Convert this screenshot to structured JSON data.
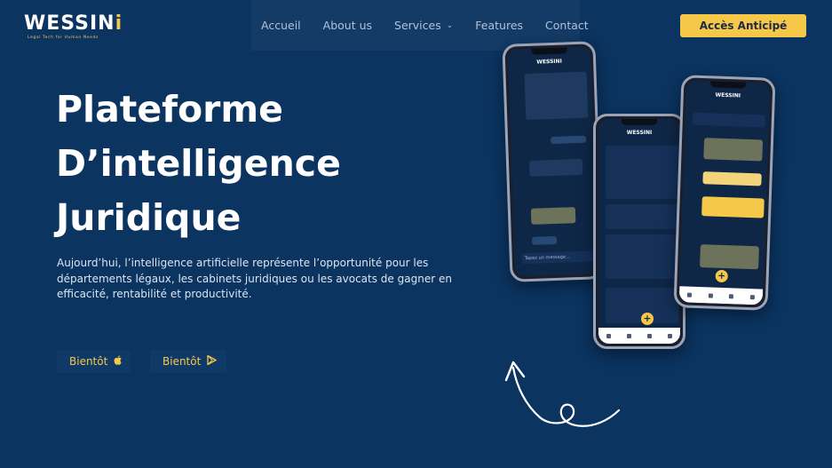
{
  "brand": {
    "name_main": "WESSIN",
    "name_dot": "i",
    "tagline": "Legal Tech for Human Needs"
  },
  "nav": {
    "items": [
      "Accueil",
      "About us",
      "Services",
      "Features",
      "Contact"
    ]
  },
  "cta": {
    "label": "Accès Anticipé"
  },
  "hero": {
    "title_line1": "Plateforme",
    "title_line2": "D’intelligence",
    "title_line3": "Juridique",
    "description": "Aujourd’hui, l’intelligence artificielle représente l’opportunité pour les départements légaux, les cabinets juridiques ou les avocats de gagner en efficacité, rentabilité et productivité."
  },
  "store_buttons": [
    {
      "label": "Bientôt",
      "icon": "apple-icon"
    },
    {
      "label": "Bientôt",
      "icon": "google-play-icon"
    }
  ],
  "phones": {
    "brand": "WESSINI",
    "chat_input_placeholder": "Tapez un message..."
  },
  "colors": {
    "background": "#0b3461",
    "accent": "#f6c84a",
    "text": "#ffffff"
  }
}
